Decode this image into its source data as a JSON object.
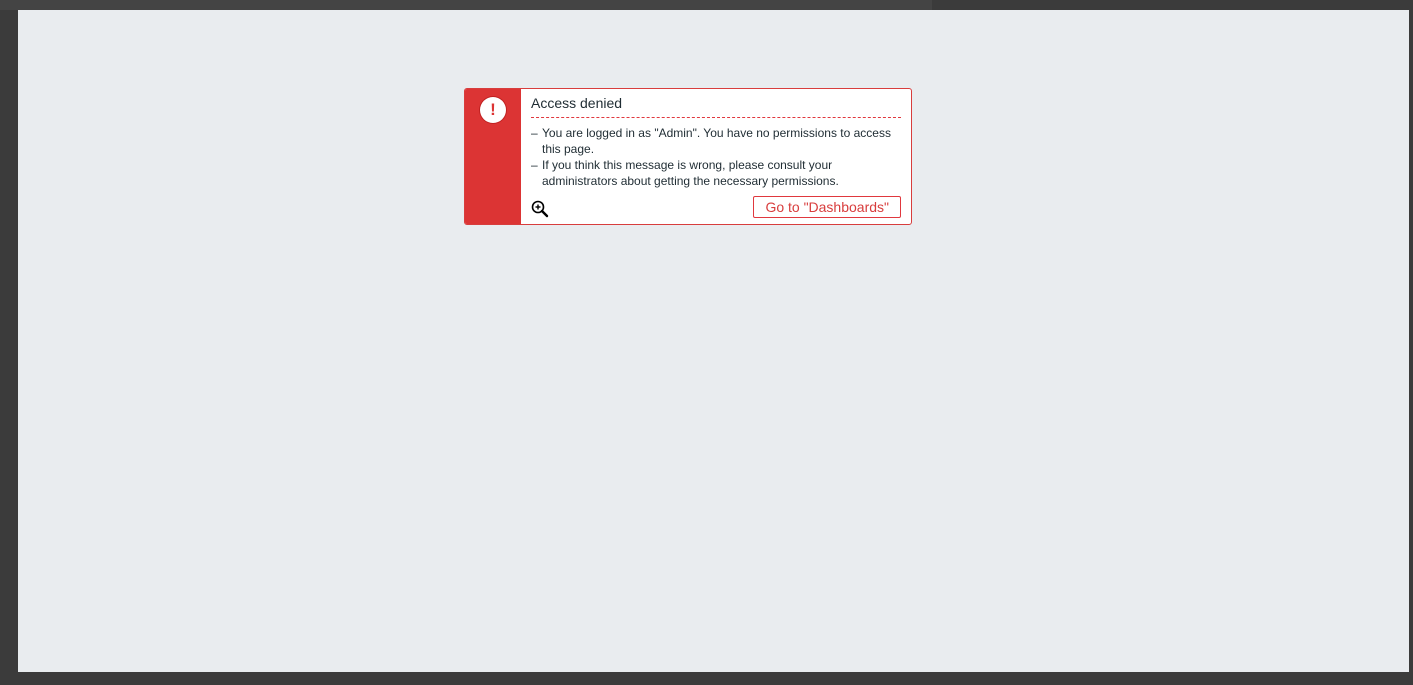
{
  "message": {
    "title": "Access denied",
    "icon": "exclamation-circle-icon",
    "details": [
      "You are logged in as \"Admin\". You have no permissions to access this page.",
      "If you think this message is wrong, please consult your administrators about getting the necessary permissions."
    ],
    "button_label": "Go to \"Dashboards\""
  },
  "colors": {
    "accent": "#dc3434",
    "border": "#e0383e",
    "background": "#e9ecef"
  },
  "cursor": "zoom-in-icon"
}
